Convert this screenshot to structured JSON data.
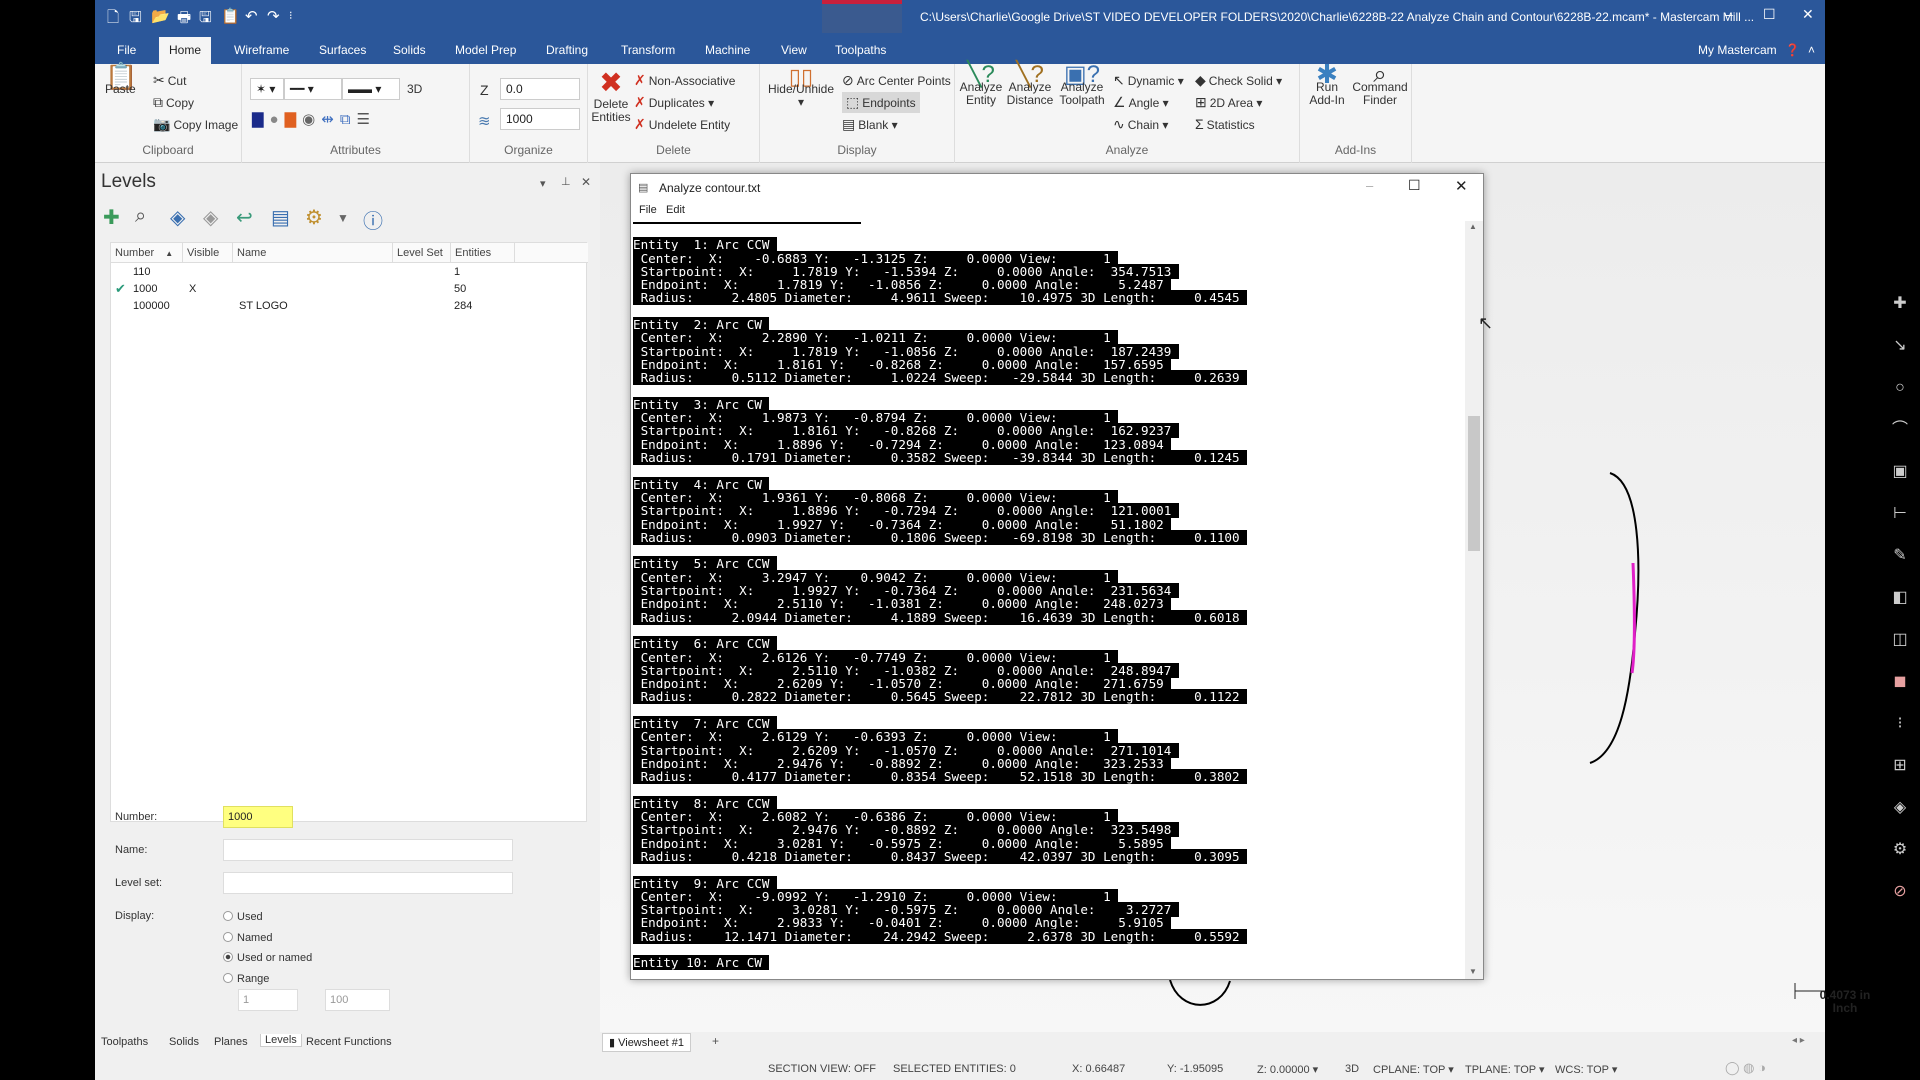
{
  "window": {
    "title": "C:\\Users\\Charlie\\Google Drive\\ST VIDEO DEVELOPER FOLDERS\\2020\\Charlie\\6228B-22 Analyze Chain and Contour\\6228B-22.mcam* - Mastercam Mill ...",
    "minimize": "‒",
    "maximize": "☐",
    "close": "✕"
  },
  "ribbon_tabs": [
    "File",
    "Home",
    "Wireframe",
    "Surfaces",
    "Solids",
    "Model Prep",
    "Drafting",
    "Transform",
    "Machine",
    "View",
    "Toolpaths"
  ],
  "active_tab": "Home",
  "my_mastercam": "My Mastercam",
  "ribbon": {
    "clipboard": {
      "label": "Clipboard",
      "paste": "Paste",
      "cut": "Cut",
      "copy": "Copy",
      "copy_image": "Copy Image"
    },
    "attributes": {
      "label": "Attributes",
      "mode": "3D"
    },
    "organize": {
      "label": "Organize",
      "z_label": "Z",
      "z_value": "0.0",
      "level_value": "1000"
    },
    "delete": {
      "label": "Delete",
      "delete_entities": "Delete Entities",
      "non_associative": "Non-Associative",
      "duplicates": "Duplicates",
      "undelete": "Undelete Entity"
    },
    "display": {
      "label": "Display",
      "hide_unhide": "Hide/Unhide",
      "arc_center": "Arc Center Points",
      "endpoints": "Endpoints",
      "blank": "Blank"
    },
    "analyze": {
      "label": "Analyze",
      "entity": "Analyze Entity",
      "distance": "Analyze Distance",
      "toolpath": "Analyze Toolpath",
      "dynamic": "Dynamic",
      "angle": "Angle",
      "chain": "Chain",
      "check_solid": "Check Solid",
      "area_2d": "2D Area",
      "statistics": "Statistics"
    },
    "addins": {
      "label": "Add-Ins",
      "run": "Run Add-In",
      "finder": "Command Finder"
    }
  },
  "levels": {
    "title": "Levels",
    "columns": [
      "Number",
      "Visible",
      "Name",
      "Level Set",
      "Entities"
    ],
    "rows": [
      {
        "number": "110",
        "visible": "",
        "name": "",
        "level_set": "",
        "entities": "1",
        "active": false
      },
      {
        "number": "1000",
        "visible": "X",
        "name": "",
        "level_set": "",
        "entities": "50",
        "active": true
      },
      {
        "number": "100000",
        "visible": "",
        "name": "ST LOGO",
        "level_set": "",
        "entities": "284",
        "active": false
      }
    ],
    "form": {
      "number_label": "Number:",
      "number_value": "1000",
      "name_label": "Name:",
      "name_value": "",
      "levelset_label": "Level set:",
      "levelset_value": "",
      "display_label": "Display:",
      "options": [
        "Used",
        "Named",
        "Used or named",
        "Range"
      ],
      "selected": "Used or named",
      "range_from": "1",
      "range_to": "100"
    }
  },
  "bottom_tabs": [
    "Toolpaths",
    "Solids",
    "Planes",
    "Levels",
    "Recent Functions"
  ],
  "active_bottom_tab": "Levels",
  "viewsheet": {
    "label": "Viewsheet #1",
    "add": "+"
  },
  "scale": {
    "value": "0.4073 in",
    "unit": "Inch"
  },
  "status": {
    "section": "SECTION VIEW: OFF",
    "selected": "SELECTED ENTITIES: 0",
    "x": "X:  0.66487",
    "y": "Y:  -1.95095",
    "z": "Z:  0.00000",
    "mode": "3D",
    "cplane": "CPLANE: TOP",
    "tplane": "TPLANE: TOP",
    "wcs": "WCS: TOP"
  },
  "dialog": {
    "title": "Analyze contour.txt",
    "menu": [
      "File",
      "Edit"
    ],
    "entities": [
      {
        "n": 1,
        "type": "Arc CCW",
        "center": [
          "-0.6883",
          "-1.3125",
          "0.0000",
          "1"
        ],
        "start": [
          "1.7819",
          "-1.5394",
          "0.0000",
          "354.7513"
        ],
        "end": [
          "1.7819",
          "-1.0856",
          "0.0000",
          "5.2487"
        ],
        "radius": "2.4805",
        "diameter": "4.9611",
        "sweep": "10.4975",
        "length": "0.4545"
      },
      {
        "n": 2,
        "type": "Arc CW",
        "center": [
          "2.2890",
          "-1.0211",
          "0.0000",
          "1"
        ],
        "start": [
          "1.7819",
          "-1.0856",
          "0.0000",
          "187.2439"
        ],
        "end": [
          "1.8161",
          "-0.8268",
          "0.0000",
          "157.6595"
        ],
        "radius": "0.5112",
        "diameter": "1.0224",
        "sweep": "-29.5844",
        "length": "0.2639"
      },
      {
        "n": 3,
        "type": "Arc CW",
        "center": [
          "1.9873",
          "-0.8794",
          "0.0000",
          "1"
        ],
        "start": [
          "1.8161",
          "-0.8268",
          "0.0000",
          "162.9237"
        ],
        "end": [
          "1.8896",
          "-0.7294",
          "0.0000",
          "123.0894"
        ],
        "radius": "0.1791",
        "diameter": "0.3582",
        "sweep": "-39.8344",
        "length": "0.1245"
      },
      {
        "n": 4,
        "type": "Arc CW",
        "center": [
          "1.9361",
          "-0.8068",
          "0.0000",
          "1"
        ],
        "start": [
          "1.8896",
          "-0.7294",
          "0.0000",
          "121.0001"
        ],
        "end": [
          "1.9927",
          "-0.7364",
          "0.0000",
          "51.1802"
        ],
        "radius": "0.0903",
        "diameter": "0.1806",
        "sweep": "-69.8198",
        "length": "0.1100"
      },
      {
        "n": 5,
        "type": "Arc CCW",
        "center": [
          "3.2947",
          "0.9042",
          "0.0000",
          "1"
        ],
        "start": [
          "1.9927",
          "-0.7364",
          "0.0000",
          "231.5634"
        ],
        "end": [
          "2.5110",
          "-1.0381",
          "0.0000",
          "248.0273"
        ],
        "radius": "2.0944",
        "diameter": "4.1889",
        "sweep": "16.4639",
        "length": "0.6018"
      },
      {
        "n": 6,
        "type": "Arc CCW",
        "center": [
          "2.6126",
          "-0.7749",
          "0.0000",
          "1"
        ],
        "start": [
          "2.5110",
          "-1.0382",
          "0.0000",
          "248.8947"
        ],
        "end": [
          "2.6209",
          "-1.0570",
          "0.0000",
          "271.6759"
        ],
        "radius": "0.2822",
        "diameter": "0.5645",
        "sweep": "22.7812",
        "length": "0.1122"
      },
      {
        "n": 7,
        "type": "Arc CCW",
        "center": [
          "2.6129",
          "-0.6393",
          "0.0000",
          "1"
        ],
        "start": [
          "2.6209",
          "-1.0570",
          "0.0000",
          "271.1014"
        ],
        "end": [
          "2.9476",
          "-0.8892",
          "0.0000",
          "323.2533"
        ],
        "radius": "0.4177",
        "diameter": "0.8354",
        "sweep": "52.1518",
        "length": "0.3802"
      },
      {
        "n": 8,
        "type": "Arc CCW",
        "center": [
          "2.6082",
          "-0.6386",
          "0.0000",
          "1"
        ],
        "start": [
          "2.9476",
          "-0.8892",
          "0.0000",
          "323.5498"
        ],
        "end": [
          "3.0281",
          "-0.5975",
          "0.0000",
          "5.5895"
        ],
        "radius": "0.4218",
        "diameter": "0.8437",
        "sweep": "42.0397",
        "length": "0.3095"
      },
      {
        "n": 9,
        "type": "Arc CCW",
        "center": [
          "-9.0992",
          "-1.2910",
          "0.0000",
          "1"
        ],
        "start": [
          "3.0281",
          "-0.5975",
          "0.0000",
          "3.2727"
        ],
        "end": [
          "2.9833",
          "-0.0401",
          "0.0000",
          "5.9105"
        ],
        "radius": "12.1471",
        "diameter": "24.2942",
        "sweep": "2.6378",
        "length": "0.5592"
      },
      {
        "n": 10,
        "type": "Arc CW"
      }
    ]
  },
  "colors": {
    "titlebar": "#2b579a",
    "highlight": "#e020c8",
    "active_level": "#ffff80"
  }
}
